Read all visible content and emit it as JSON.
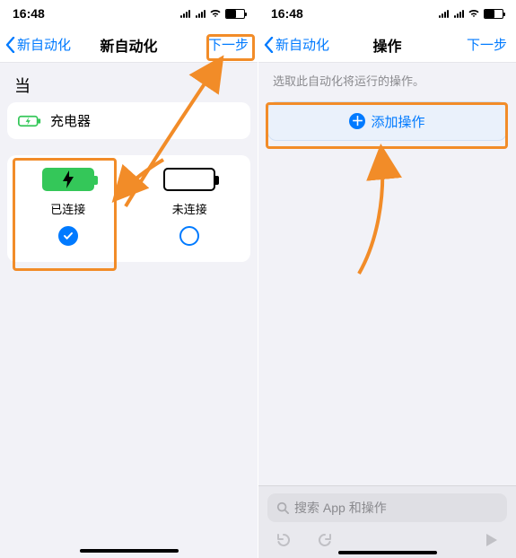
{
  "status": {
    "time": "16:48"
  },
  "left": {
    "back": "新自动化",
    "title": "新自动化",
    "next": "下一步",
    "when": "当",
    "row_charger": "充电器",
    "opt_connected": "已连接",
    "opt_disconnected": "未连接"
  },
  "right": {
    "back": "新自动化",
    "title": "操作",
    "next": "下一步",
    "subtext": "选取此自动化将运行的操作。",
    "add_action": "添加操作",
    "search_placeholder": "搜索 App 和操作"
  }
}
